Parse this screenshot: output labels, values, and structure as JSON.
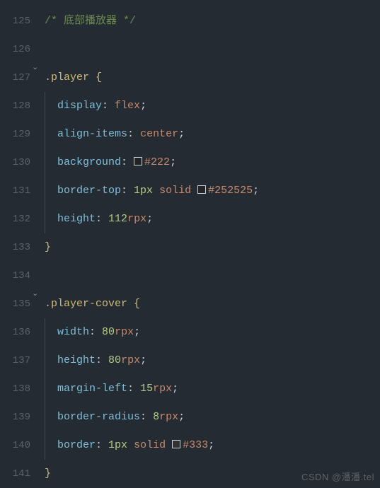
{
  "lineNumbers": [
    "125",
    "126",
    "127",
    "128",
    "129",
    "130",
    "131",
    "132",
    "133",
    "134",
    "135",
    "136",
    "137",
    "138",
    "139",
    "140",
    "141"
  ],
  "folds": [
    {
      "line": 127,
      "glyph": "⌄"
    },
    {
      "line": 135,
      "glyph": "⌄"
    }
  ],
  "chart_data": {
    "type": "table",
    "title": "CSS source snippet",
    "lines": [
      "/* 底部播放器 */",
      "",
      ".player {",
      "  display: flex;",
      "  align-items: center;",
      "  background: #222;",
      "  border-top: 1px solid #252525;",
      "  height: 112rpx;",
      "}",
      "",
      ".player-cover {",
      "  width: 80rpx;",
      "  height: 80rpx;",
      "  margin-left: 15rpx;",
      "  border-radius: 8rpx;",
      "  border: 1px solid #333;",
      "}"
    ]
  },
  "tokens": {
    "comment": "/* 底部播放器 */",
    "sel_player": ".player",
    "sel_cover": ".player-cover",
    "open": " {",
    "close": "}",
    "colon": ": ",
    "semi": ";",
    "sp": " ",
    "solid": "solid",
    "p_display": "display",
    "v_flex": "flex",
    "p_align": "align-items",
    "v_center": "center",
    "p_bg": "background",
    "c_222": "#222",
    "p_btop": "border-top",
    "v_1px": "1px",
    "c_252525": "#252525",
    "p_height": "height",
    "n_112": "112",
    "u_rpx": "rpx",
    "p_width": "width",
    "n_80": "80",
    "p_ml": "margin-left",
    "n_15": "15",
    "p_br": "border-radius",
    "n_8": "8",
    "p_border": "border",
    "c_333": "#333"
  },
  "swatches": {
    "c_222": "#222222",
    "c_252525": "#252525",
    "c_333": "#333333"
  },
  "watermark": "CSDN @潘潘.tel"
}
